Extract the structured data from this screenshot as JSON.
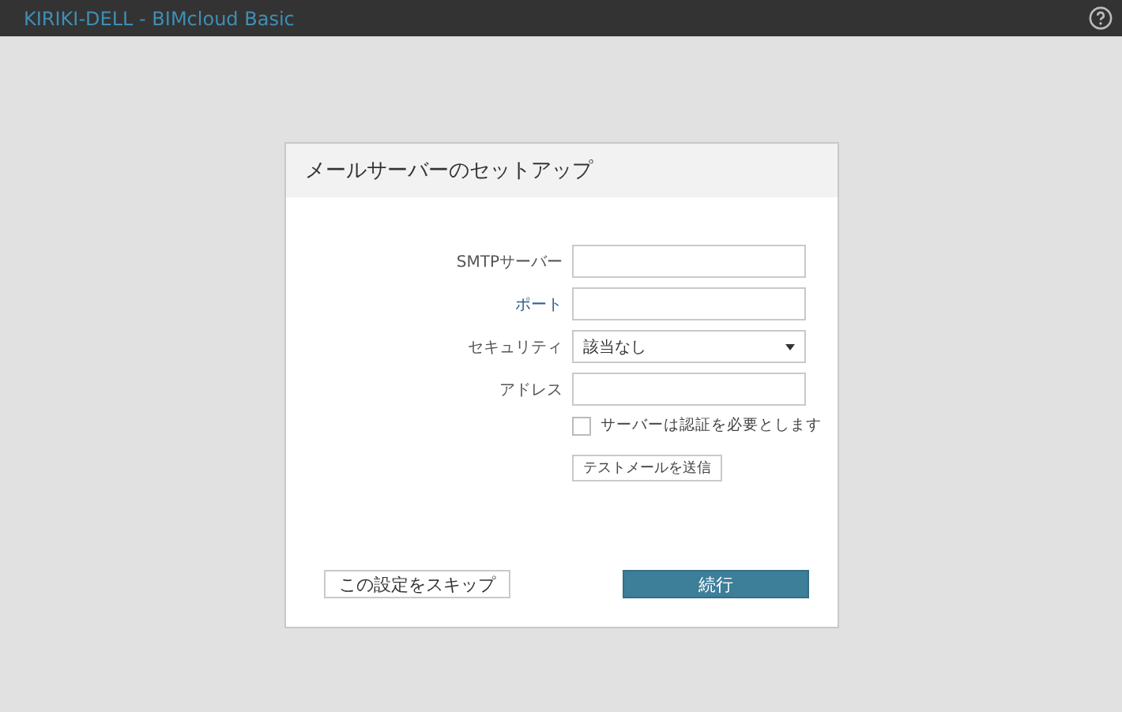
{
  "window": {
    "title": "KIRIKI-DELL - BIMcloud Basic"
  },
  "dialog": {
    "title": "メールサーバーのセットアップ",
    "fields": [
      {
        "kind": "text",
        "label": "SMTPサーバー",
        "highlighted": false
      },
      {
        "kind": "text",
        "label": "ポート",
        "highlighted": true
      },
      {
        "kind": "select",
        "label": "セキュリティ",
        "value": "該当なし",
        "highlighted": false
      },
      {
        "kind": "text",
        "label": "アドレス",
        "highlighted": false
      }
    ],
    "auth_checkbox": {
      "label": "サーバーは認証を必要とします",
      "checked": false
    },
    "test_button": "テストメールを送信",
    "skip_button": "この設定をスキップ",
    "continue_button": "続行"
  }
}
